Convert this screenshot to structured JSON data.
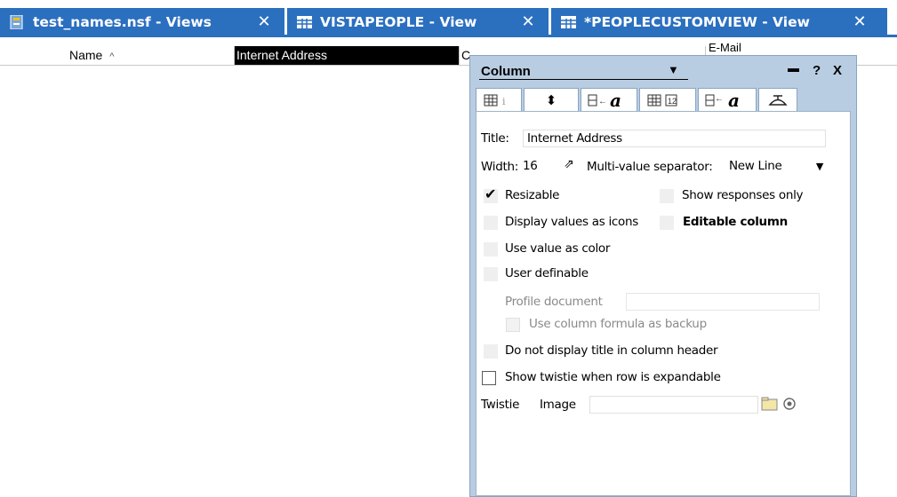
{
  "tabs": [
    {
      "label": "test_names.nsf - Views",
      "icon": "database-icon",
      "close": "✕"
    },
    {
      "label": "VISTAPEOPLE - View",
      "icon": "view-icon",
      "close": "✕"
    },
    {
      "label": "*PEOPLECUSTOMVIEW - View",
      "icon": "view-icon",
      "close": "✕"
    }
  ],
  "view": {
    "columns": [
      "Name",
      "Internet Address",
      "C",
      "E-Mail"
    ],
    "sort_glyph": "^"
  },
  "panel": {
    "title": "Column",
    "help": "?",
    "close": "X",
    "tabs": [
      "basics-tab",
      "sorting-tab",
      "font-tab",
      "numbers-tab",
      "title-font-tab",
      "advanced-tab"
    ],
    "title_label": "Title:",
    "title_value": "Internet Address",
    "width_label": "Width:",
    "width_value": "16",
    "separator_label": "Multi-value separator:",
    "separator_value": "New Line",
    "resizable": "Resizable",
    "show_responses_only": "Show responses only",
    "display_icons": "Display values as icons",
    "editable_column": "Editable column",
    "use_value_as_color": "Use value as color",
    "user_definable": "User definable",
    "profile_document": "Profile document",
    "use_formula_backup": "Use column formula as backup",
    "no_title_header": "Do not display title in column header",
    "show_twistie": "Show twistie when row is expandable",
    "twistie_label": "Twistie",
    "image_label": "Image"
  },
  "colors": {
    "tab_blue": "#2b6fbf",
    "panel_bg": "#b9cde2",
    "selected_header": "#000000"
  }
}
